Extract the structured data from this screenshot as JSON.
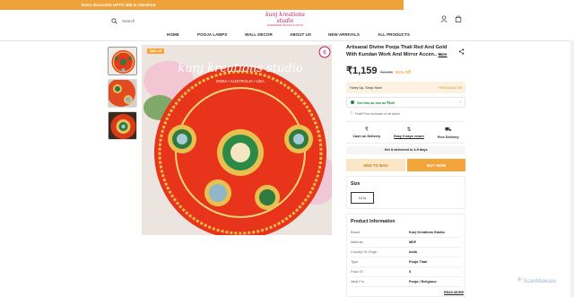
{
  "promo": {
    "text": "Extra discounts UPTO 40$ at checkout"
  },
  "header": {
    "search_label": "Search",
    "logo_brand": "kunj kreations studio",
    "logo_tagline": "HANDMADE DECOR & GIFTS"
  },
  "nav": {
    "items": [
      {
        "label": "HOME"
      },
      {
        "label": "POOJA LAMPS"
      },
      {
        "label": "WALL DECOR"
      },
      {
        "label": "ABOUT US"
      },
      {
        "label": "NEW ARRIVALS"
      },
      {
        "label": "ALL PRODUCTS"
      }
    ]
  },
  "product": {
    "sale_badge": "Sale off",
    "title": "Artisanal Divine Pooja Thali Red And Gold With Kundan Work And Mirror Accen..",
    "more_label": "More",
    "price": "₹1,159",
    "mrp": "₹2,399",
    "discount": "51% Off",
    "image_overlay_title": "kunj kreations studio",
    "image_overlay_sub": "INDIA • AUSTRALIA • USA"
  },
  "hurry": {
    "text": "Hurry Up, Shop Now!",
    "phone": "+919311461728"
  },
  "offer": {
    "text": "Get this as low as ₹849"
  },
  "inclusive": "Final Price inclusive of all taxes",
  "features": [
    {
      "icon": "rupee-icon",
      "label": "Cash on Delivery"
    },
    {
      "icon": "return-icon",
      "label": "Easy 5 days return"
    },
    {
      "icon": "truck-icon",
      "label": "Free Delivery"
    }
  ],
  "delivery_text": "Get it delivered in 4-9 days",
  "buttons": {
    "add_to_bag": "ADD TO BAG",
    "buy_now": "BUY NOW"
  },
  "size": {
    "heading": "Size",
    "selected": "12 In"
  },
  "product_info": {
    "heading": "Product Information",
    "rows": [
      {
        "key": "Brand",
        "value": "Kunj Kreations Studio"
      },
      {
        "key": "Material",
        "value": "MDF"
      },
      {
        "key": "Country Of Origin",
        "value": "India"
      },
      {
        "key": "Type",
        "value": "Pooja Thali"
      },
      {
        "key": "Pack Of",
        "value": "5"
      },
      {
        "key": "Ideal For",
        "value": "Pooja / Religious"
      }
    ],
    "read_more": "READ MORE"
  },
  "watermark": "ScanMalware",
  "colors": {
    "accent": "#f3a53b",
    "offer_green": "#1b8a3c",
    "logo_pink": "#c2185b"
  }
}
